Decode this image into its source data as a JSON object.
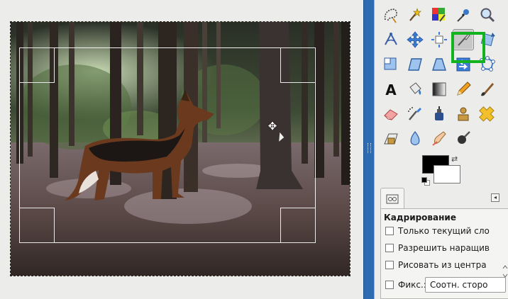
{
  "tools": [
    {
      "name": "free-select-tool-icon"
    },
    {
      "name": "fuzzy-select-tool-icon"
    },
    {
      "name": "select-by-color-tool-icon"
    },
    {
      "name": "color-picker-tool-icon"
    },
    {
      "name": "zoom-tool-icon"
    },
    {
      "name": "measure-tool-icon"
    },
    {
      "name": "move-tool-icon"
    },
    {
      "name": "align-tool-icon"
    },
    {
      "name": "crop-tool-icon"
    },
    {
      "name": "rotate-tool-icon"
    },
    {
      "name": "scale-tool-icon"
    },
    {
      "name": "shear-tool-icon"
    },
    {
      "name": "perspective-tool-icon"
    },
    {
      "name": "flip-tool-icon"
    },
    {
      "name": "cage-transform-tool-icon"
    },
    {
      "name": "text-tool-icon"
    },
    {
      "name": "bucket-fill-tool-icon"
    },
    {
      "name": "blend-tool-icon"
    },
    {
      "name": "pencil-tool-icon"
    },
    {
      "name": "paintbrush-tool-icon"
    },
    {
      "name": "eraser-tool-icon"
    },
    {
      "name": "airbrush-tool-icon"
    },
    {
      "name": "ink-tool-icon"
    },
    {
      "name": "clone-tool-icon"
    },
    {
      "name": "heal-tool-icon"
    },
    {
      "name": "perspective-clone-tool-icon"
    },
    {
      "name": "blur-sharpen-tool-icon"
    },
    {
      "name": "smudge-tool-icon"
    },
    {
      "name": "dodge-burn-tool-icon"
    }
  ],
  "active_tool": "crop-tool-icon",
  "colors": {
    "foreground": "#000000",
    "background": "#ffffff",
    "highlight": "#13b31f",
    "dock_divider": "#2d6bb3"
  },
  "tool_options": {
    "title": "Кадрирование",
    "options": [
      {
        "label": "Только текущий сло",
        "checked": false
      },
      {
        "label": "Разрешить наращив",
        "checked": false
      },
      {
        "label": "Рисовать из центра",
        "checked": false
      }
    ],
    "fixed_label": "Фикс.:",
    "fixed_checked": false,
    "aspect_value": "Соотн. сторо"
  }
}
